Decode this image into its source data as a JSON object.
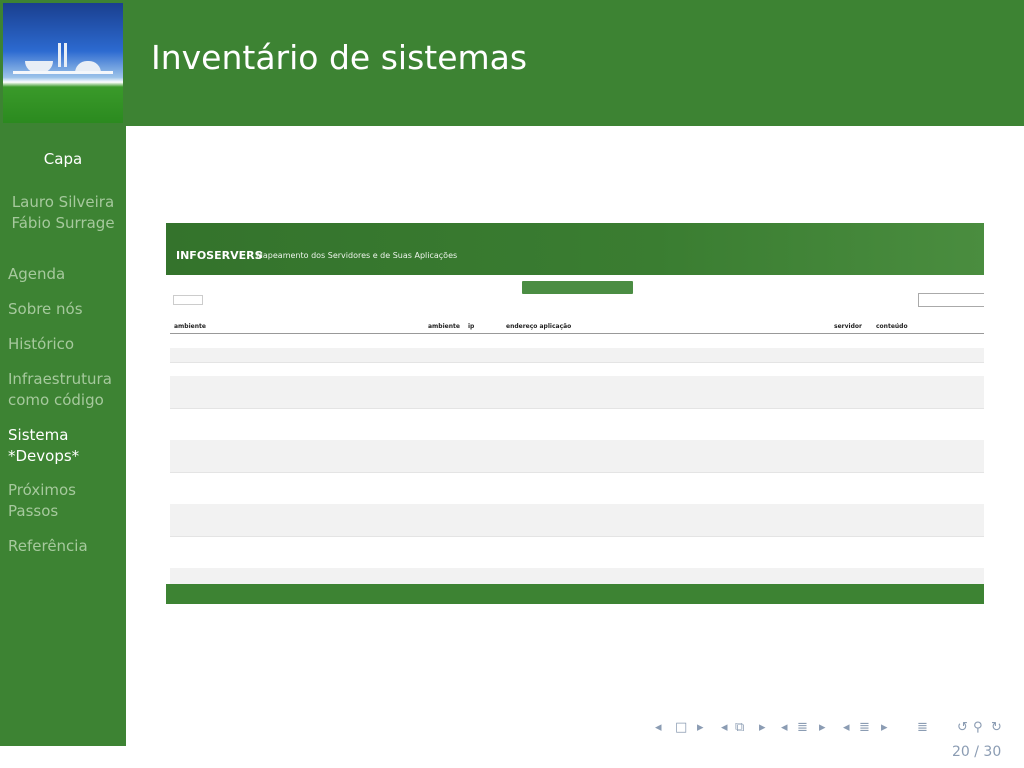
{
  "slide": {
    "title": "Inventário de sistemas",
    "page_number": "20 / 30"
  },
  "sidebar": {
    "capa": "Capa",
    "authors": [
      "Lauro Silveira",
      "Fábio Surrage"
    ],
    "items": [
      {
        "label": "Agenda"
      },
      {
        "label": "Sobre nós"
      },
      {
        "label": "Histórico"
      },
      {
        "label": "Infraestrutura como código"
      },
      {
        "label": "Sistema *Devops*"
      },
      {
        "label": "Próximos Passos"
      },
      {
        "label": "Referência"
      }
    ]
  },
  "screenshot": {
    "app_name": "INFOSERVERS",
    "subtitle": "Mapeamento dos Servidores e de Suas Aplicações",
    "columns": [
      "ambiente",
      "ambiente",
      "ip",
      "endereço aplicação",
      "servidor",
      "conteúdo"
    ]
  },
  "colors": {
    "accent": "#3d8333",
    "sidebar_text": "#a6c99d",
    "nav_symbols": "#8b9cb3"
  }
}
